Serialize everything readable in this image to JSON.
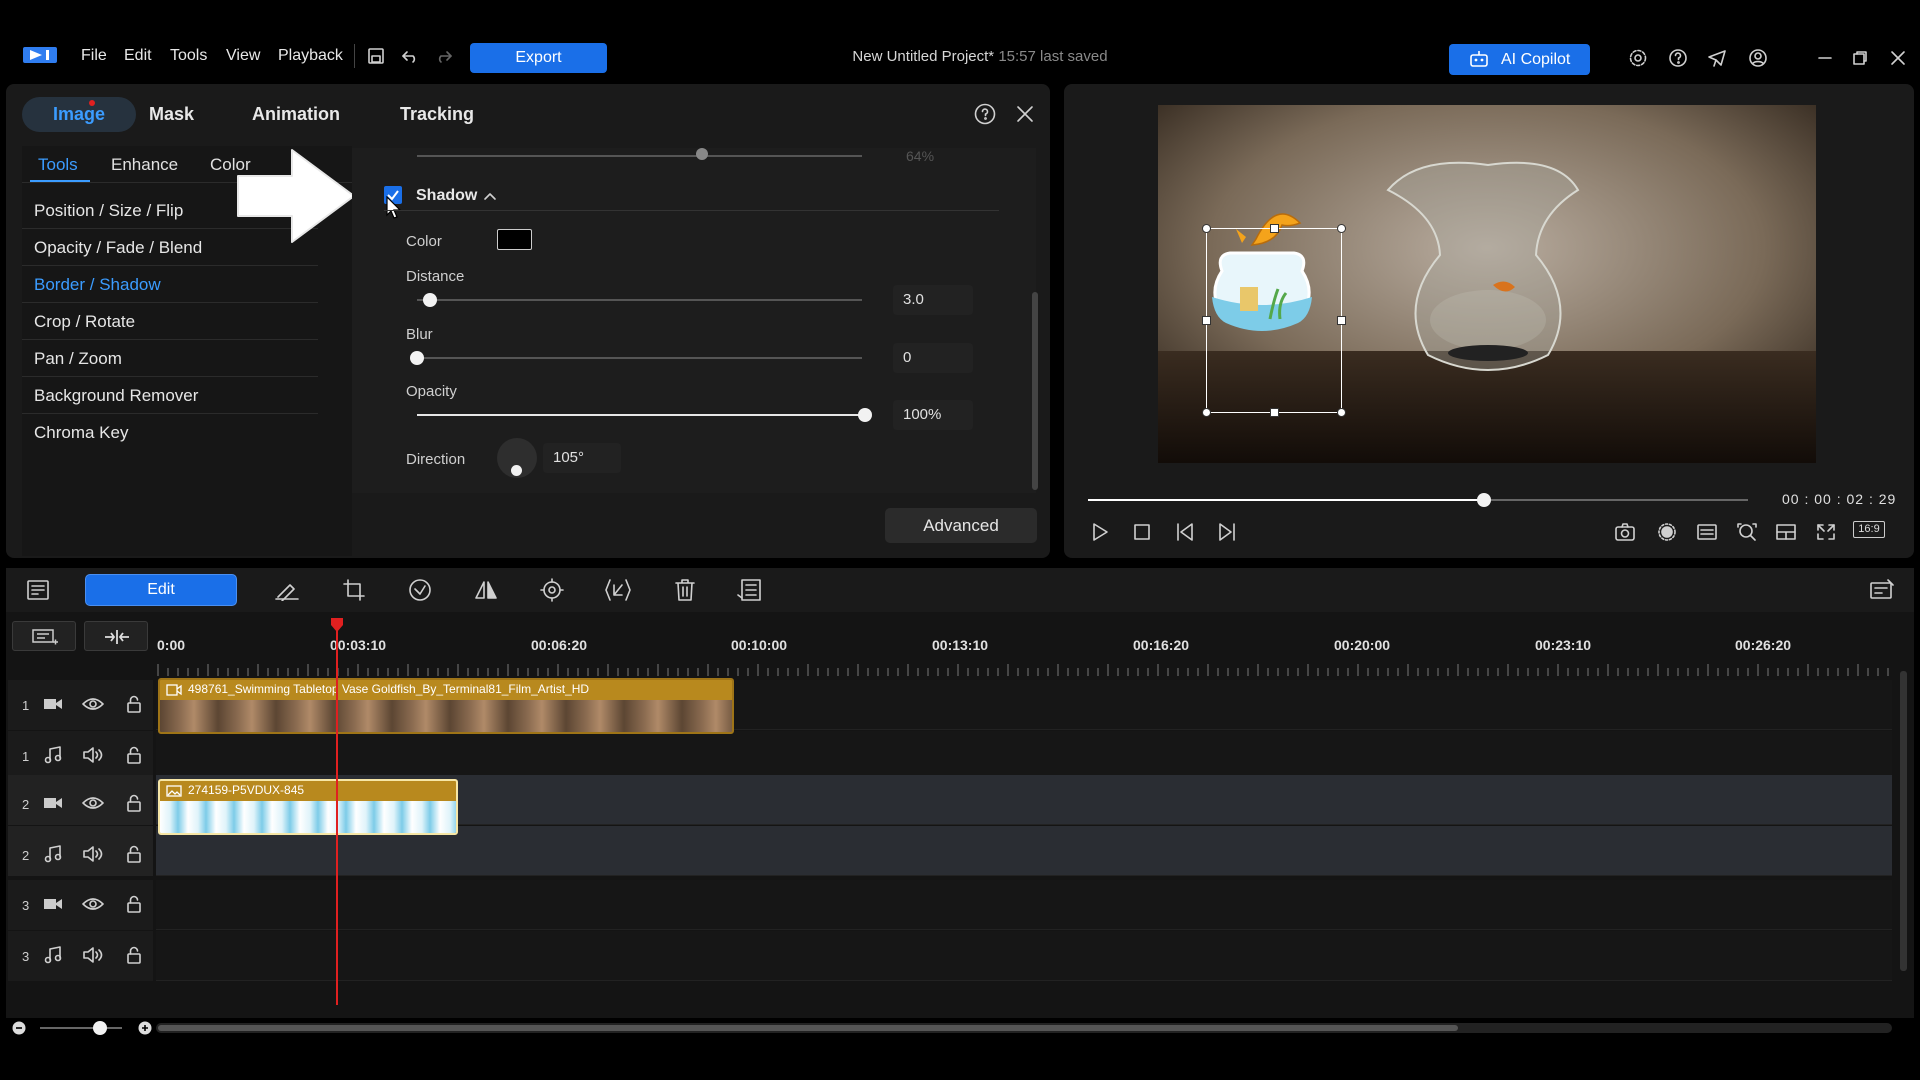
{
  "menu": {
    "file": "File",
    "edit": "Edit",
    "tools": "Tools",
    "view": "View",
    "playback": "Playback"
  },
  "export_label": "Export",
  "project": {
    "title": "New Untitled Project*",
    "saved": "15:57 last saved"
  },
  "copilot_label": "AI Copilot",
  "top_tabs": {
    "image": "Image",
    "mask": "Mask",
    "animation": "Animation",
    "tracking": "Tracking"
  },
  "sub_tabs": {
    "tools": "Tools",
    "enhance": "Enhance",
    "color": "Color"
  },
  "tools_list": [
    "Position / Size / Flip",
    "Opacity / Fade / Blend",
    "Border / Shadow",
    "Crop / Rotate",
    "Pan / Zoom",
    "Background Remover",
    "Chroma Key"
  ],
  "shadow": {
    "header": "Shadow",
    "checked": true,
    "prev_value": "64%",
    "color_label": "Color",
    "distance_label": "Distance",
    "distance_value": "3.0",
    "distance_fraction": 0.03,
    "blur_label": "Blur",
    "blur_value": "0",
    "blur_fraction": 0.0,
    "opacity_label": "Opacity",
    "opacity_value": "100%",
    "opacity_fraction": 1.0,
    "direction_label": "Direction",
    "direction_value": "105°"
  },
  "advanced_label": "Advanced",
  "playback": {
    "timecode": "00 : 00 : 02 : 29",
    "progress_fraction": 0.6,
    "aspect": "16:9"
  },
  "toolbar": {
    "edit_label": "Edit"
  },
  "timeline": {
    "ticks": [
      "0:00",
      "00:03:10",
      "00:06:20",
      "00:10:00",
      "00:13:10",
      "00:16:20",
      "00:20:00",
      "00:23:10",
      "00:26:20"
    ],
    "tracks": [
      {
        "num": "1",
        "type": "video"
      },
      {
        "num": "1",
        "type": "audio"
      },
      {
        "num": "2",
        "type": "video"
      },
      {
        "num": "2",
        "type": "audio"
      },
      {
        "num": "3",
        "type": "video"
      },
      {
        "num": "3",
        "type": "audio"
      }
    ],
    "clip1_name": "498761_Swimming Tabletop Vase Goldfish_By_Terminal81_Film_Artist_HD",
    "clip2_name": "274159-P5VDUX-845"
  },
  "colors": {
    "accent": "#1a6fe8",
    "playhead": "#e02020",
    "clip": "#b8891e"
  }
}
